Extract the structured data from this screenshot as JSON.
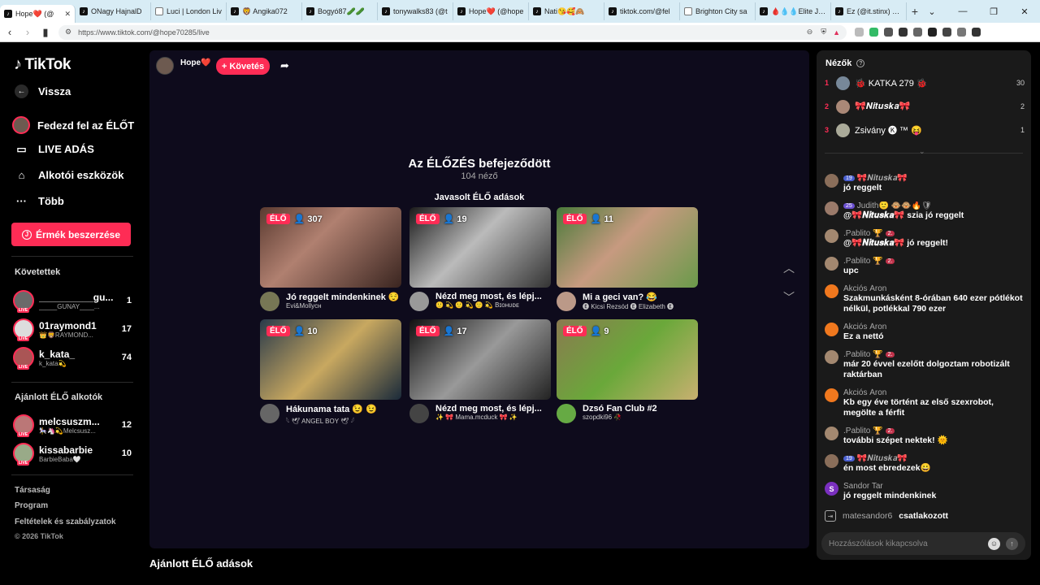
{
  "browser": {
    "tabs": [
      {
        "title": "Hope❤️ (@"
      },
      {
        "title": "ONagy HajnalD"
      },
      {
        "title": "Luci | London Liv"
      },
      {
        "title": "🦁 Angika072"
      },
      {
        "title": "Bogyó87🥒🥒"
      },
      {
        "title": "tonywalks83 (@t"
      },
      {
        "title": "Hope❤️ (@hope"
      },
      {
        "title": "Nati😘🥰🙈"
      },
      {
        "title": "tiktok.com/@fel"
      },
      {
        "title": "Brighton City sa"
      },
      {
        "title": "🩸💧💧Elite Jáno"
      },
      {
        "title": "Ez (@it.stinx) ÉLŐ"
      }
    ],
    "new_tab": "+",
    "url": "https://www.tiktok.com/@hope70285/live"
  },
  "sidebar": {
    "logo": "TikTok",
    "back": "Vissza",
    "nav": [
      {
        "label": "Fedezd fel az ÉLŐT"
      },
      {
        "label": "LIVE ADÁS"
      },
      {
        "label": "Alkotói eszközök"
      },
      {
        "label": "Több"
      }
    ],
    "coins_button": "Érmék beszerzése",
    "following_title": "Követettek",
    "following": [
      {
        "name": "__________gu...",
        "sub": "_____GUNAY____...",
        "count": "1"
      },
      {
        "name": "01raymond1",
        "sub": "👑🦁RAYMOND...",
        "count": "17"
      },
      {
        "name": "k_kata_",
        "sub": "k_kata💫",
        "count": "74"
      }
    ],
    "suggested_title": "Ajánlott ÉLŐ alkotók",
    "suggested": [
      {
        "name": "melcsuszm...",
        "sub": "🎠🦄💫Melcsusz...",
        "count": "12"
      },
      {
        "name": "kissabarbie",
        "sub": "BarbieBaba🤍",
        "count": "10"
      }
    ],
    "footer": [
      "Társaság",
      "Program",
      "Feltételek és szabályzatok",
      "© 2026 TikTok"
    ]
  },
  "main": {
    "host_name": "Hope❤️",
    "follow_button": "+ Követés",
    "ended_title": "Az ÉLŐZÉS befejeződött",
    "viewers": "104 néző",
    "suggested_title": "Javasolt ÉLŐ adások",
    "live_label": "ÉLŐ",
    "cards": [
      {
        "viewers": "307",
        "title": "Jó reggelt mindenkinek 😌",
        "host": "Evi&Mollyᴄʜ"
      },
      {
        "viewers": "19",
        "title": "Nézd meg most, és lépj...",
        "host": "🙂 💫 🙂 💫 🙂 💫 Bɪᴏʜᴜᴅᴇ"
      },
      {
        "viewers": "11",
        "title": "Mi a geci van? 😂",
        "host": "🅔 Kicsi Rezsód 🅔 Elizabeth 🅔"
      },
      {
        "viewers": "10",
        "title": "Hákunama tata 😉 😉",
        "host": "𓆩 🕊 ANGEL BOY 🕊 𓆪"
      },
      {
        "viewers": "17",
        "title": "Nézd meg most, és lépj...",
        "host": "✨ 🎀 Mama.mcduck 🎀 ✨"
      },
      {
        "viewers": "9",
        "title": "Dzsó Fan Club #2",
        "host": "szopdki96 🥀"
      }
    ],
    "bottom_title": "Ajánlott ÉLŐ adások"
  },
  "chat": {
    "viewers_title": "Nézők",
    "top_viewers": [
      {
        "rank": "1",
        "name": "🐞 KATKA 279 🐞",
        "score": "30"
      },
      {
        "rank": "2",
        "name": "🎀𝑵𝒊𝒕𝒖𝒔𝒌𝒂🎀",
        "score": "2"
      },
      {
        "rank": "3",
        "name": "Zsivány 🅚 ™ 😝",
        "score": "1"
      }
    ],
    "messages": [
      {
        "user": "🎀𝑵𝒊𝒕𝒖𝒔𝒌𝒂🎀",
        "badge": "19",
        "text": "jó reggelt",
        "color": "#8a6e5a"
      },
      {
        "user": "Judith🙂 🐵🐵🔥🛡",
        "badge": "25",
        "text": "@🎀𝑵𝒊𝒕𝒖𝒔𝒌𝒂🎀 szia jó reggelt",
        "color": "#9a7a6a"
      },
      {
        "user": ".Pablito 🏆",
        "badge": "2.",
        "text": "@🎀𝑵𝒊𝒕𝒖𝒔𝒌𝒂🎀 jó reggelt!",
        "color": "#a38870"
      },
      {
        "user": ".Pablito 🏆",
        "badge": "2.",
        "text": "upc",
        "color": "#a38870"
      },
      {
        "user": "Akciós Áron",
        "badge": "",
        "text": "Szakmunkásként 8-órában 640 ezer pótlékot nélkül, potlékkal 790 ezer",
        "color": "#f0781e"
      },
      {
        "user": "Akciós Áron",
        "badge": "",
        "text": "Ez a nettó",
        "color": "#f0781e"
      },
      {
        "user": ".Pablito 🏆",
        "badge": "2.",
        "text": "már 20 évvel ezelőtt dolgoztam robotizált raktárban",
        "color": "#a38870"
      },
      {
        "user": "Akciós Áron",
        "badge": "",
        "text": "Kb egy éve történt az első szexrobot, megölte a férfit",
        "color": "#f0781e"
      },
      {
        "user": ".Pablito 🏆",
        "badge": "2.",
        "text": "további szépet nektek! 🌞",
        "color": "#a38870"
      },
      {
        "user": "🎀𝑵𝒊𝒕𝒖𝒔𝒌𝒂🎀",
        "badge": "19",
        "text": "én most ebredezek😀",
        "color": "#8a6e5a"
      },
      {
        "user": "Sandor Tar",
        "badge": "",
        "text": "jó reggelt mindenkinek",
        "color": "#7a2fbf",
        "initial": "S"
      }
    ],
    "joined_user": "matesandor6",
    "joined_text": "csatlakozott",
    "input_placeholder": "Hozzászólások kikapcsolva"
  }
}
